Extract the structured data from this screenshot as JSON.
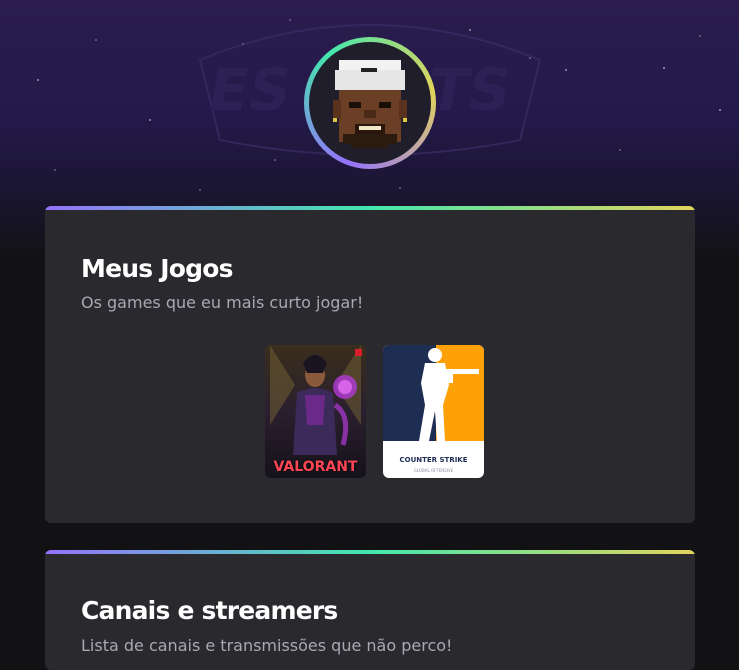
{
  "profile": {
    "avatar_icon": "pixel-art-avatar-icon"
  },
  "games_section": {
    "title": "Meus Jogos",
    "subtitle": "Os games que eu mais curto jogar!",
    "games": [
      {
        "label": "VALORANT",
        "icon": "valorant-cover"
      },
      {
        "label": "COUNTER STRIKE",
        "sub": "GLOBAL OFFENSIVE",
        "icon": "counter-strike-cover"
      }
    ]
  },
  "streams_section": {
    "title": "Canais e streamers",
    "subtitle": "Lista de canais e transmissões que não perco!"
  },
  "colors": {
    "background": "#121214",
    "card": "#29292e",
    "gradient": [
      "#9572fc",
      "#43e7ad",
      "#e2d45c"
    ],
    "title": "#ffffff",
    "subtitle": "#a8a8b3"
  }
}
